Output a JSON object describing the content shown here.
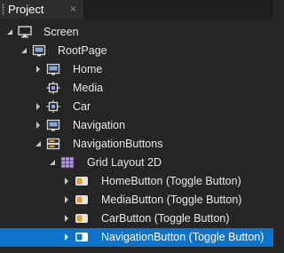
{
  "panel": {
    "tab_label": "Project",
    "close_glyph": "×"
  },
  "tree": {
    "screen": "Screen",
    "root_page": "RootPage",
    "home": "Home",
    "media": "Media",
    "car": "Car",
    "navigation": "Navigation",
    "navigation_buttons": "NavigationButtons",
    "grid_layout": "Grid Layout 2D",
    "home_button": "HomeButton (Toggle Button)",
    "media_button": "MediaButton (Toggle Button)",
    "car_button": "CarButton (Toggle Button)",
    "navigation_button": "NavigationButton (Toggle Button)"
  },
  "colors": {
    "selection": "#0e72c8",
    "background": "#252526",
    "icon_accent": "#e0a030"
  }
}
